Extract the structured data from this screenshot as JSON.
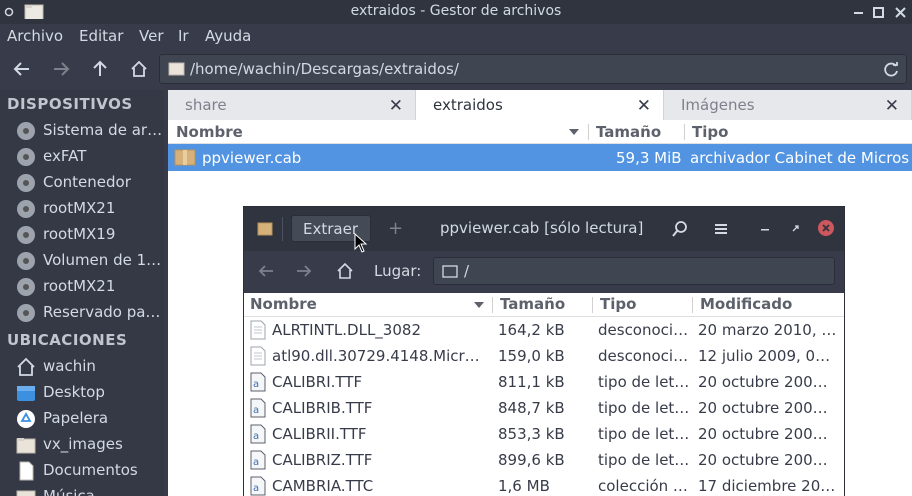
{
  "window": {
    "title": "extraidos - Gestor de archivos"
  },
  "menu": {
    "items": [
      "Archivo",
      "Editar",
      "Ver",
      "Ir",
      "Ayuda"
    ]
  },
  "toolbar": {
    "path": "/home/wachin/Descargas/extraidos/"
  },
  "sidebar": {
    "devices_header": "DISPOSITIVOS",
    "devices": [
      "Sistema de ar…",
      "exFAT",
      "Contenedor",
      "rootMX21",
      "rootMX19",
      "Volumen de 1…",
      "rootMX21",
      "Reservado pa…"
    ],
    "places_header": "UBICACIONES",
    "places": [
      {
        "label": "wachin",
        "icon": "home-icon"
      },
      {
        "label": "Desktop",
        "icon": "desktop-folder-icon"
      },
      {
        "label": "Papelera",
        "icon": "trash-icon"
      },
      {
        "label": "vx_images",
        "icon": "folder-icon"
      },
      {
        "label": "Documentos",
        "icon": "document-icon"
      },
      {
        "label": "Música",
        "icon": "music-folder-icon"
      }
    ]
  },
  "tabs": [
    {
      "label": "share",
      "active": false
    },
    {
      "label": "extraidos",
      "active": true
    },
    {
      "label": "Imágenes",
      "active": false
    }
  ],
  "columns": {
    "name": "Nombre",
    "size": "Tamaño",
    "type": "Tipo"
  },
  "files": [
    {
      "name": "ppviewer.cab",
      "size": "59,3 MiB",
      "type": "archivador Cabinet de Micros"
    }
  ],
  "archive_dialog": {
    "extract_label": "Extraer",
    "add_label": "+",
    "title": "ppviewer.cab [sólo lectura]",
    "location_label": "Lugar:",
    "location_value": "/",
    "columns": {
      "name": "Nombre",
      "size": "Tamaño",
      "type": "Tipo",
      "modified": "Modificado"
    },
    "rows": [
      {
        "name": "ALRTINTL.DLL_3082",
        "size": "164,2 kB",
        "type": "desconoci…",
        "modified": "20 marzo 2010, …",
        "icon": "file-icon"
      },
      {
        "name": "atl90.dll.30729.4148.Micr…",
        "size": "159,0 kB",
        "type": "desconoci…",
        "modified": "12 julio 2009, 0…",
        "icon": "file-icon"
      },
      {
        "name": "CALIBRI.TTF",
        "size": "811,1 kB",
        "type": "tipo de let…",
        "modified": "20 octubre 200…",
        "icon": "font-icon"
      },
      {
        "name": "CALIBRIB.TTF",
        "size": "848,7 kB",
        "type": "tipo de let…",
        "modified": "20 octubre 200…",
        "icon": "font-icon"
      },
      {
        "name": "CALIBRII.TTF",
        "size": "853,3 kB",
        "type": "tipo de let…",
        "modified": "20 octubre 200…",
        "icon": "font-icon"
      },
      {
        "name": "CALIBRIZ.TTF",
        "size": "899,6 kB",
        "type": "tipo de let…",
        "modified": "20 octubre 200…",
        "icon": "font-icon"
      },
      {
        "name": "CAMBRIA.TTC",
        "size": "1,6 MB",
        "type": "colección …",
        "modified": "17 diciembre 20…",
        "icon": "font-icon"
      }
    ]
  },
  "colors": {
    "accent": "#5294e2",
    "dark_bg": "#383c4a",
    "titlebar": "#2f343f",
    "close_red": "#cc575d"
  }
}
